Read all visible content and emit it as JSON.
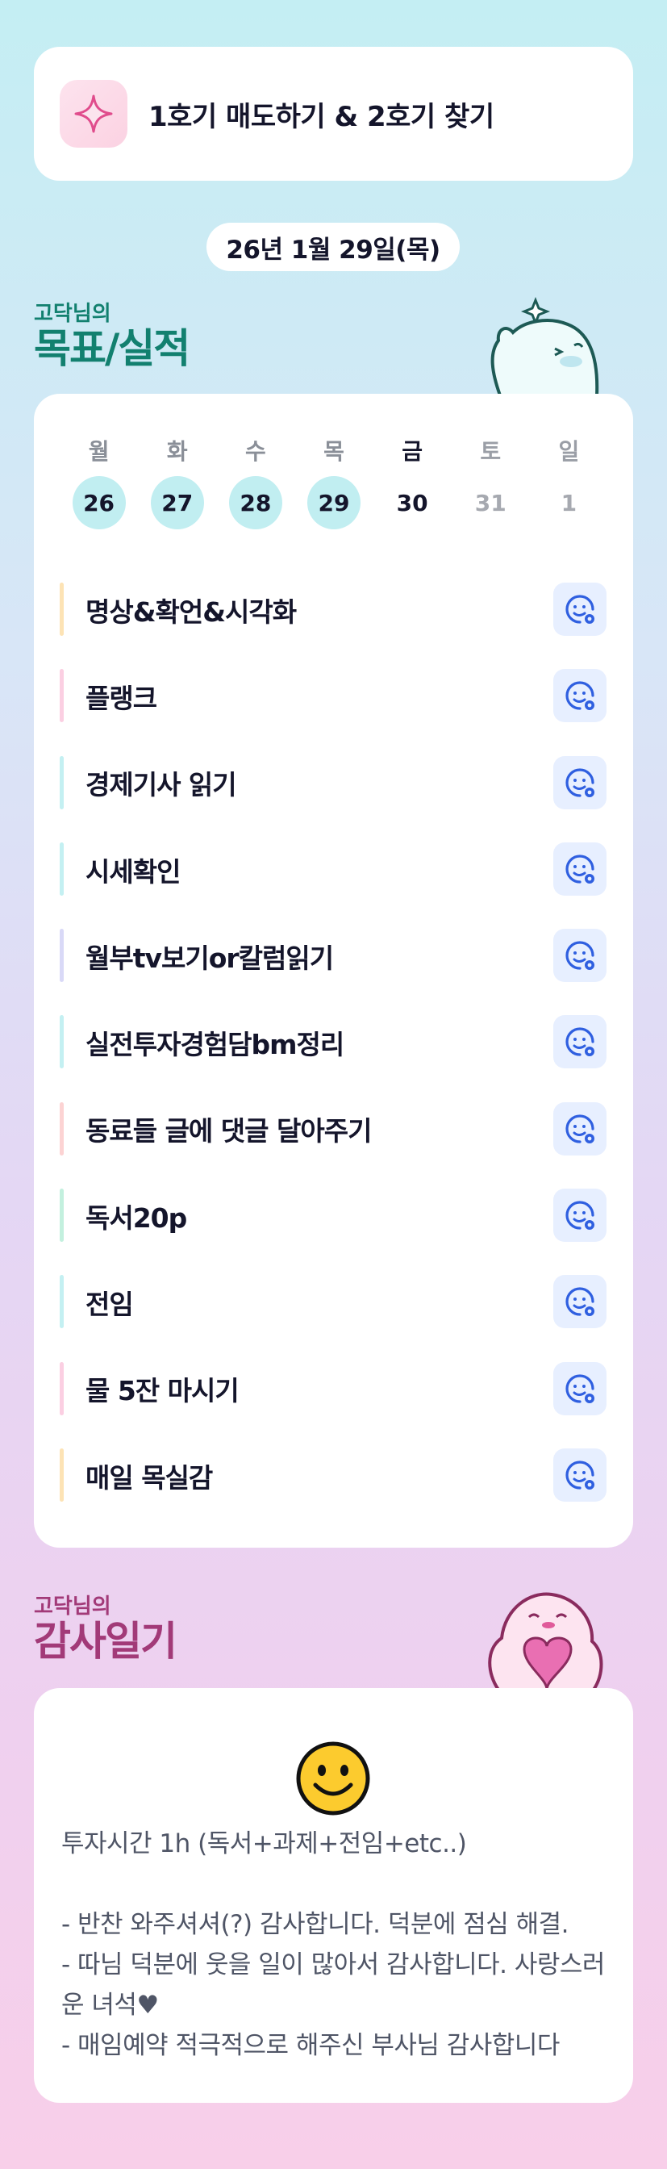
{
  "goal": {
    "text": "1호기 매도하기 & 2호기 찾기",
    "icon": "sparkle-icon"
  },
  "date": "26년 1월 29일(목)",
  "goals_section": {
    "small": "고닥님의",
    "big": "목표/실적"
  },
  "week": {
    "days": [
      {
        "weekday": "월",
        "date": "26",
        "done": true
      },
      {
        "weekday": "화",
        "date": "27",
        "done": true
      },
      {
        "weekday": "수",
        "date": "28",
        "done": true
      },
      {
        "weekday": "목",
        "date": "29",
        "done": true
      },
      {
        "weekday": "금",
        "date": "30",
        "done": false
      },
      {
        "weekday": "토",
        "date": "31",
        "done": false
      },
      {
        "weekday": "일",
        "date": "1",
        "done": false
      }
    ]
  },
  "tasks": [
    {
      "label": "명상&확언&시각화",
      "color": "#fde3b5"
    },
    {
      "label": "플랭크",
      "color": "#fbcfe2"
    },
    {
      "label": "경제기사 읽기",
      "color": "#c4f0f2"
    },
    {
      "label": "시세확인",
      "color": "#c4f0f2"
    },
    {
      "label": "월부tv보기or칼럼읽기",
      "color": "#d9d9f7"
    },
    {
      "label": "실전투자경험담bm정리",
      "color": "#c4f0f2"
    },
    {
      "label": "동료들 글에 댓글 달아주기",
      "color": "#fcd3d3"
    },
    {
      "label": "독서20p",
      "color": "#c3f0de"
    },
    {
      "label": "전임",
      "color": "#c4f0f2"
    },
    {
      "label": "물 5잔 마시기",
      "color": "#fbcfe2"
    },
    {
      "label": "매일 목실감",
      "color": "#fde3b5"
    }
  ],
  "check_icon": "smile-check-icon",
  "thanks_section": {
    "small": "고닥님의",
    "big": "감사일기"
  },
  "thanks": {
    "emoji": "smiling-face-icon",
    "text": "투자시간 1h (독서+과제+전임+etc..)\n\n- 반찬 와주셔셔(?) 감사합니다. 덕분에 점심 해결.\n- 따님 덕분에 웃을 일이 많아서 감사합니다. 사랑스러운 녀석♥\n- 매임예약 적극적으로 해주신 부사님 감사합니다"
  },
  "colors": {
    "accent_teal": "#12806f",
    "accent_pink": "#a23a78",
    "done_day": "#c1eef1",
    "check_blue": "#2f5fe0"
  }
}
